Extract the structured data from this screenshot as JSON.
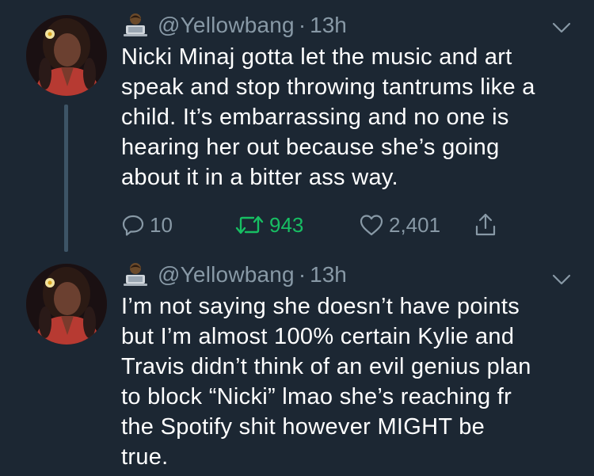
{
  "tweets": [
    {
      "handle": "@Yellowbang",
      "separator": "·",
      "time": "13h",
      "lines": [
        "Nicki Minaj gotta let the music and art",
        "speak and stop throwing tantrums like a",
        "child. It’s embarrassing and no one is",
        "hearing her out because she’s going",
        "about it in a bitter ass way."
      ],
      "reply_count": "10",
      "retweet_count": "943",
      "like_count": "2,401"
    },
    {
      "handle": "@Yellowbang",
      "separator": "·",
      "time": "13h",
      "lines": [
        "I’m not saying she doesn’t have points",
        "but I’m almost 100% certain Kylie and",
        "Travis didn’t think of an evil genius plan",
        "to block “Nicki” lmao she’s reaching fr",
        "the Spotify shit however MIGHT be",
        "true."
      ]
    }
  ],
  "icons": {
    "reply": "reply-icon",
    "retweet": "retweet-icon",
    "like": "heart-icon",
    "share": "share-icon",
    "menu": "chevron-down-icon",
    "badge": "technologist-emoji-icon"
  },
  "colors": {
    "background": "#1c2733",
    "text": "#ffffff",
    "secondary": "#8899a6",
    "retweet_active": "#17bf63",
    "thread_line": "#3d5466"
  }
}
